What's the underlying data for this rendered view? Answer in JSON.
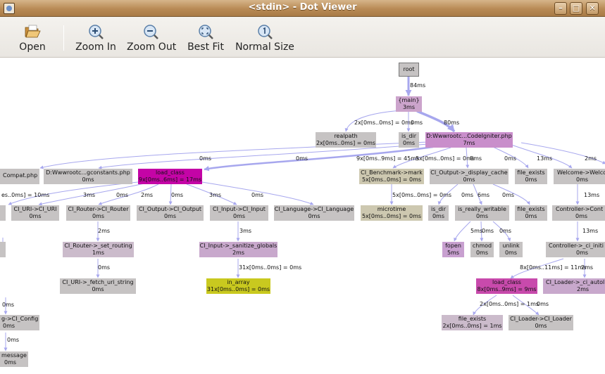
{
  "window": {
    "title": "<stdin> - Dot Viewer",
    "min_glyph": "–",
    "max_glyph": "□",
    "close_glyph": "✕"
  },
  "toolbar": {
    "open_label": "Open",
    "zoom_in_label": "Zoom In",
    "zoom_out_label": "Zoom Out",
    "best_fit_label": "Best Fit",
    "normal_size_label": "Normal Size"
  },
  "graph": {
    "nodes": {
      "root": {
        "l1": "root",
        "l2": ""
      },
      "main": {
        "l1": "{main}",
        "l2": "3ms"
      },
      "realpath": {
        "l1": "realpath",
        "l2": "2x[0ms..0ms] = 0ms"
      },
      "is_dir_top": {
        "l1": "is_dir",
        "l2": "0ms"
      },
      "codeigniter": {
        "l1": "D:Wwwrootc...CodeIgniter.php",
        "l2": "7ms"
      },
      "compat": {
        "l1": "Compat.php",
        "l2": ""
      },
      "constants": {
        "l1": "D:Wwwrootc...gconstants.php",
        "l2": "0ms"
      },
      "load_class_top": {
        "l1": "load_class",
        "l2": "9x[0ms..6ms] = 17ms"
      },
      "benchmark_mark": {
        "l1": "CI_Benchmark->mark",
        "l2": "5x[0ms..0ms] = 0ms"
      },
      "output_cache": {
        "l1": "CI_Output->_display_cache",
        "l2": "0ms"
      },
      "file_exists_top": {
        "l1": "file_exists",
        "l2": "0ms"
      },
      "welcome": {
        "l1": "Welcome->Welco",
        "l2": "0ms"
      },
      "left_clip_node": {
        "l1": "",
        "l2": ""
      },
      "uri_uri": {
        "l1": "CI_URI->CI_URI",
        "l2": "0ms"
      },
      "router_router": {
        "l1": "CI_Router->CI_Router",
        "l2": "0ms"
      },
      "output_output": {
        "l1": "CI_Output->CI_Output",
        "l2": "0ms"
      },
      "input_input": {
        "l1": "CI_Input->CI_Input",
        "l2": "0ms"
      },
      "language_language": {
        "l1": "CI_Language->CI_Language",
        "l2": "0ms"
      },
      "microtime": {
        "l1": "microtime",
        "l2": "5x[0ms..0ms] = 0ms"
      },
      "is_dir_mid": {
        "l1": "is_dir",
        "l2": "0ms"
      },
      "is_really_writable": {
        "l1": "is_really_writable",
        "l2": "0ms"
      },
      "file_exists_mid": {
        "l1": "file_exists",
        "l2": "0ms"
      },
      "controller_cont": {
        "l1": "Controller->Cont",
        "l2": "0ms"
      },
      "set_routing": {
        "l1": "CI_Router->_set_routing",
        "l2": "1ms"
      },
      "sanitize_globals": {
        "l1": "CI_Input->_sanitize_globals",
        "l2": "2ms"
      },
      "fopen": {
        "l1": "fopen",
        "l2": "5ms"
      },
      "chmod": {
        "l1": "chmod",
        "l2": "0ms"
      },
      "unlink": {
        "l1": "unlink",
        "l2": "0ms"
      },
      "ci_initi": {
        "l1": "Controller->_ci_initi",
        "l2": "0ms"
      },
      "fetch_uri_string": {
        "l1": "CI_URI->_fetch_uri_string",
        "l2": "0ms"
      },
      "in_array": {
        "l1": "in_array",
        "l2": "31x[0ms..0ms] = 0ms"
      },
      "load_class_bottom": {
        "l1": "load_class",
        "l2": "8x[0ms..9ms] = 9ms"
      },
      "ci_autol": {
        "l1": "CI_Loader->_ci_autol",
        "l2": "2ms"
      },
      "ci_config": {
        "l1": "g->CI_Config",
        "l2": "0ms"
      },
      "file_exists_bottom": {
        "l1": "file_exists",
        "l2": "2x[0ms..0ms] = 1ms"
      },
      "ci_loader": {
        "l1": "CI_Loader->CI_Loader",
        "l2": "0ms"
      },
      "message": {
        "l1": "message",
        "l2": "0ms"
      }
    },
    "edge_labels": {
      "root_main": "84ms",
      "main_realpath": "2x[0ms..0ms] = 0ms",
      "main_is_dir": "0ms",
      "main_codeigniter": "80ms",
      "ci_compat": "0ms",
      "ci_constants": "0ms",
      "ci_benchmark": "9x[0ms..9ms] = 45ms",
      "ci_output_cache": "5x[0ms..0ms] = 0ms",
      "ci_output_cache_b": "8ms",
      "ci_file_exists": "0ms",
      "ci_welcome": "13ms",
      "ci_right": "2ms",
      "lc_left": "es..0ms] = 10ms",
      "lc_router": "3ms",
      "lc_output": "0ms",
      "lc_output2": "2ms",
      "lc_output3": "0ms",
      "lc_input": "3ms",
      "lc_language": "0ms",
      "bench_microtime": "5x[0ms..0ms] = 0ms",
      "oc_is_dir": "0ms",
      "oc_writable": "6ms",
      "oc_file_exists": "0ms",
      "welcome_cont": "13ms",
      "router_setrouting": "2ms",
      "input_sanitize": "3ms",
      "irw_fopen": "5ms",
      "irw_chmod": "0ms",
      "irw_unlink": "0ms",
      "cont_initi": "13ms",
      "sr_fetch": "0ms",
      "sg_inarray": "31x[0ms..0ms] = 0ms",
      "initi_lc": "8x[0ms..11ms] = 11ms",
      "initi_autol": "2ms",
      "lcb_file_exists": "2x[0ms..0ms] = 1ms",
      "lcb_loader": "0ms",
      "left_config_a": "0ms",
      "left_config_b": "0ms"
    }
  },
  "colors": {
    "default_node": "#c6c3c3",
    "main_node": "#cca4cc",
    "codeigniter_node": "#c98ecb",
    "hot_node": "#c404a6",
    "benchmark_node": "#cdc8b0",
    "in_array_node": "#c9c91f",
    "fopen_node": "#c8a0d0",
    "edge": "#a7a7ee",
    "titlebar": "#b88a55"
  },
  "icons": {
    "open": "folder-open-icon",
    "zoom_in": "zoom-in-icon",
    "zoom_out": "zoom-out-icon",
    "best_fit": "zoom-fit-icon",
    "normal_size": "zoom-normal-icon"
  }
}
